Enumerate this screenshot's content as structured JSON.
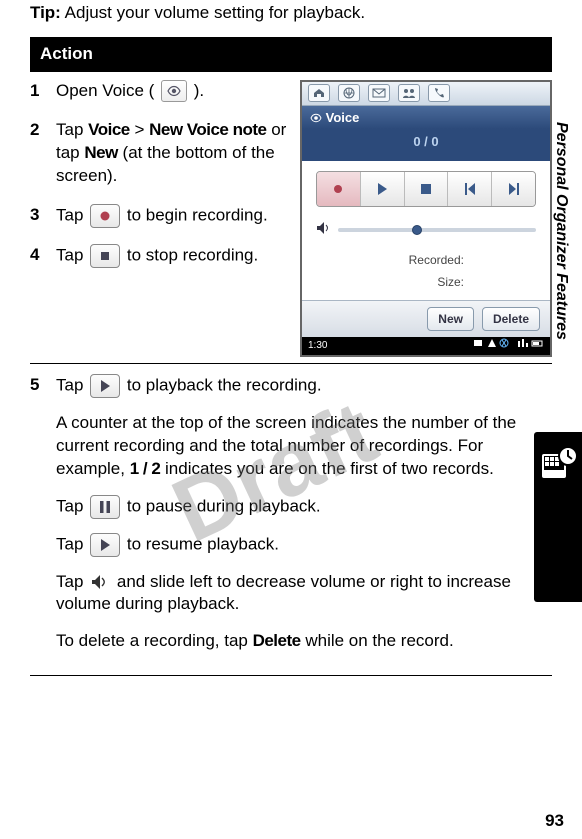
{
  "tip": {
    "label": "Tip:",
    "text": "Adjust your volume setting for playback."
  },
  "action_header": "Action",
  "steps": {
    "s1": {
      "num": "1",
      "text_a": "Open Voice (",
      "text_b": ")."
    },
    "s2": {
      "num": "2",
      "text_a": "Tap ",
      "voice": "Voice",
      "gt": " > ",
      "nvn": "New Voice note",
      "or": " or tap ",
      "new": "New",
      "rest": " (at the bottom of the screen)."
    },
    "s3": {
      "num": "3",
      "text_a": "Tap ",
      "text_b": " to begin recording."
    },
    "s4": {
      "num": "4",
      "text_a": "Tap ",
      "text_b": " to stop recording."
    },
    "s5": {
      "num": "5",
      "p1a": "Tap ",
      "p1b": " to playback the recording.",
      "p2a": "A counter at the top of the screen indicates the number of the current recording and the total number of recordings. For example, ",
      "p2_bold": "1 / 2",
      "p2b": " indicates you are on the first of two records.",
      "p3a": "Tap ",
      "p3b": " to pause during playback.",
      "p4a": "Tap ",
      "p4b": " to resume playback.",
      "p5a": "Tap ",
      "p5b": " and slide left to decrease volume or right to increase volume during playback.",
      "p6a": "To delete a recording, tap  ",
      "p6_bold": "Delete",
      "p6b": " while on the record."
    }
  },
  "phone": {
    "title": "Voice",
    "counter": "0 / 0",
    "recorded_label": "Recorded:",
    "size_label": "Size:",
    "btn_new": "New",
    "btn_delete": "Delete",
    "clock": "1:30"
  },
  "side_label": "Personal Organizer Features",
  "page_number": "93",
  "watermark": "Draft"
}
